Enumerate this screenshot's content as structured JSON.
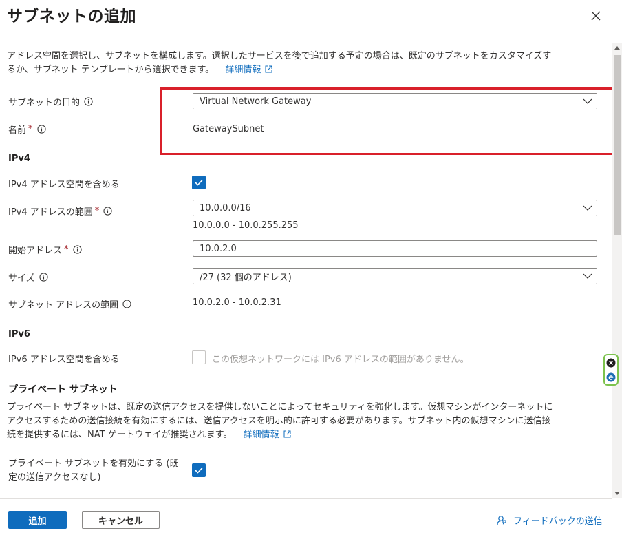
{
  "header": {
    "title": "サブネットの追加"
  },
  "intro": {
    "text_line1": "アドレス空間を選択し、サブネットを構成します。選択したサービスを後で追加する予定の場合は、既定のサブネットをカスタマイズす",
    "text_line2": "るか、サブネット テンプレートから選択できます。",
    "link": "詳細情報"
  },
  "form": {
    "purpose": {
      "label": "サブネットの目的",
      "value": "Virtual Network Gateway"
    },
    "name": {
      "label": "名前",
      "required": "*",
      "value": "GatewaySubnet"
    },
    "ipv4": {
      "heading": "IPv4",
      "include_label": "IPv4 アドレス空間を含める",
      "include_checked": true,
      "range_label": "IPv4 アドレスの範囲",
      "range_required": "*",
      "range_value": "10.0.0.0/16",
      "range_hint": "10.0.0.0 - 10.0.255.255",
      "start_label": "開始アドレス",
      "start_required": "*",
      "start_value": "10.0.2.0",
      "size_label": "サイズ",
      "size_value": "/27 (32 個のアドレス)",
      "subnet_range_label": "サブネット アドレスの範囲",
      "subnet_range_value": "10.0.2.0 - 10.0.2.31"
    },
    "ipv6": {
      "heading": "IPv6",
      "include_label": "IPv6 アドレス空間を含める",
      "include_checked": false,
      "disabled_text": "この仮想ネットワークには IPv6 アドレスの範囲がありません。"
    },
    "private": {
      "heading": "プライベート サブネット",
      "desc_line1": "プライベート サブネットは、既定の送信アクセスを提供しないことによってセキュリティを強化します。仮想マシンがインターネットに",
      "desc_line2": "アクセスするための送信接続を有効にするには、送信アクセスを明示的に許可する必要があります。サブネット内の仮想マシンに送信接",
      "desc_line3": "続を提供するには、NAT ゲートウェイが推奨されます。",
      "link": "詳細情報",
      "enable_label_line1": "プライベート サブネットを有効にする (既",
      "enable_label_line2": "定の送信アクセスなし)",
      "enable_checked": true
    }
  },
  "footer": {
    "add_label": "追加",
    "cancel_label": "キャンセル",
    "feedback_label": "フィードバックの送信"
  },
  "colors": {
    "accent": "#0f6cbd",
    "highlight": "#d9202a",
    "widget": "#7cc24d"
  }
}
